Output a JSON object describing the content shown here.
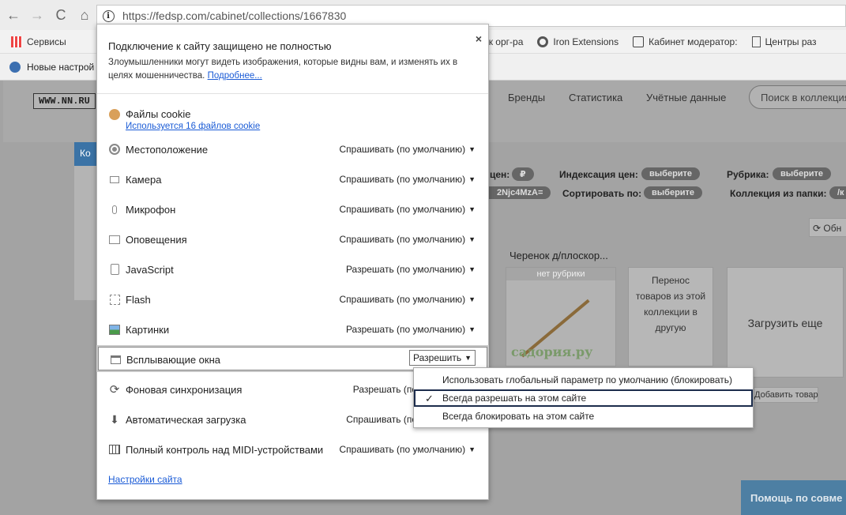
{
  "browser": {
    "url": "https://fedsp.com/cabinet/collections/1667830",
    "nav": {
      "back": "←",
      "forward": "→",
      "reload": "C",
      "home": "⌂"
    }
  },
  "bookmarks": [
    {
      "label": "Сервисы",
      "icon": "apps-grid-icon"
    },
    {
      "label": "лк орг-ра",
      "icon": "bookmark-icon"
    },
    {
      "label": "Iron Extensions",
      "icon": "gear-icon"
    },
    {
      "label": "Кабинет модератор:",
      "icon": "bookmark-icon"
    },
    {
      "label": "Центры раз",
      "icon": "page-icon"
    }
  ],
  "infobar": {
    "text": "Новые настрой"
  },
  "site": {
    "logo": "WWW.NN.RU",
    "nav": [
      "Бренды",
      "Статистика",
      "Учётные данные"
    ],
    "search_placeholder": "Поиск в коллекция",
    "sidebar_tab": "Ко",
    "filters": {
      "price_index_label": "Индексация цен:",
      "price_index_value": "выберите",
      "rubric_label": "Рубрика:",
      "rubric_value": "выберите",
      "sort_label": "Сортировать по:",
      "sort_value": "выберите",
      "folder_label": "Коллекция из папки:",
      "folder_value": "/к",
      "prices_label": "цен:",
      "prices_value": "₽",
      "code_value": "2Njc4MzA="
    },
    "refresh_label": "Обн",
    "item_title": "Черенок д/плоскор...",
    "no_rubric": "нет рубрики",
    "watermark": "садория.ру",
    "move_card": "Перенос товаров из этой коллекции в другую",
    "load_more": "Загрузить еще",
    "add_product": "Добавить товар",
    "help": "Помощь по совме"
  },
  "popup": {
    "title": "Подключение к сайту защищено не полностью",
    "close": "×",
    "description": "Злоумышленники могут видеть изображения, которые видны вам, и изменять их в целях мошенничества.",
    "more_link": "Подробнее...",
    "cookies_label": "Файлы cookie",
    "cookies_link": "Используется 16 файлов cookie",
    "permissions": [
      {
        "label": "Местоположение",
        "value": "Спрашивать (по умолчанию)",
        "icon": "location-icon"
      },
      {
        "label": "Камера",
        "value": "Спрашивать (по умолчанию)",
        "icon": "camera-icon"
      },
      {
        "label": "Микрофон",
        "value": "Спрашивать (по умолчанию)",
        "icon": "microphone-icon"
      },
      {
        "label": "Оповещения",
        "value": "Спрашивать (по умолчанию)",
        "icon": "notification-icon"
      },
      {
        "label": "JavaScript",
        "value": "Разрешать (по умолчанию)",
        "icon": "javascript-icon"
      },
      {
        "label": "Flash",
        "value": "Спрашивать (по умолчанию)",
        "icon": "flash-icon"
      },
      {
        "label": "Картинки",
        "value": "Разрешать (по умолчанию)",
        "icon": "image-icon"
      },
      {
        "label": "Всплывающие окна",
        "value": "Разрешить",
        "icon": "popup-window-icon"
      },
      {
        "label": "Фоновая синхронизация",
        "value": "Разрешать (по",
        "icon": "sync-icon"
      },
      {
        "label": "Автоматическая загрузка",
        "value": "Спрашивать (по",
        "icon": "download-icon"
      },
      {
        "label": "Полный контроль над MIDI-устройствами",
        "value": "Спрашивать (по умолчанию)",
        "icon": "midi-icon"
      }
    ],
    "site_settings": "Настройки сайта"
  },
  "dropdown": {
    "options": [
      {
        "label": "Использовать глобальный параметр по умолчанию (блокировать)",
        "selected": false
      },
      {
        "label": "Всегда разрешать на этом сайте",
        "selected": true
      },
      {
        "label": "Всегда блокировать на этом сайте",
        "selected": false
      }
    ],
    "check": "✓"
  }
}
